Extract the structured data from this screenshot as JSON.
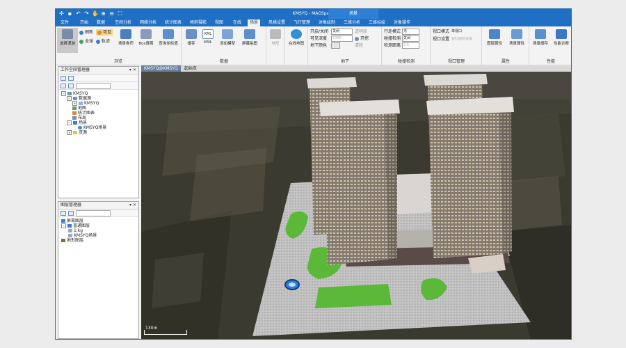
{
  "app": {
    "title": "KMSYQ - MAGSpace",
    "context_title": "场景",
    "quick_access_icons": [
      "app-logo-icon",
      "save-icon",
      "undo-icon",
      "redo-icon",
      "pan-icon",
      "zoom-in-icon",
      "zoom-out-icon",
      "full-extent-icon"
    ]
  },
  "tabs": [
    "文件",
    "开始",
    "数据",
    "空间分析",
    "网络分析",
    "统计图表",
    "倾斜摄影",
    "视图",
    "在线",
    "场景",
    "风格设置",
    "飞行管理",
    "对象绘制",
    "三维分析",
    "三维标绘",
    "对象操作"
  ],
  "active_tab": "场景",
  "ribbon": {
    "browse": {
      "label": "浏览",
      "select_mode": "选择漫游",
      "refresh": "刷新",
      "visible": "可见",
      "globe": "全球",
      "track": "轨迹",
      "scene_roll": "场景卷帘",
      "box_clip": "Box裁剪",
      "view_coord": "查询坐标值"
    },
    "data": {
      "label": "数据",
      "cache": "缓存",
      "kml": "KML",
      "add_model": "添加模型",
      "screen_image": "屏幕贴图",
      "terrain": "地形"
    },
    "online": {
      "online_map": "在线地图"
    },
    "underground": {
      "label": "地下",
      "open_close": "开启/关闭",
      "visible_depth": "可见深度",
      "underground_color": "地下颜色",
      "open_close_value": "关闭",
      "depth_value": "5000",
      "transparency": "透明度",
      "transparency_value": "50",
      "excavate": "开挖",
      "clear": "清除"
    },
    "collision": {
      "label": "碰撞检测",
      "walk_mode": "行走模式",
      "walk_mode_value": "无",
      "collision_check": "碰撞检测",
      "collision_check_value": "关闭",
      "check_distance": "检测距离",
      "check_distance_value": "0.5"
    },
    "viewport": {
      "label": "视口管理",
      "viewport_mode": "视口模式",
      "viewport_mode_value": "单视口",
      "viewport_settings": "视口设置",
      "viewport_settings_value": "视口图层设置"
    },
    "attributes": {
      "label": "属性",
      "layer_attr": "图层属性",
      "scene_attr": "场景属性"
    },
    "performance": {
      "label": "性能",
      "scene_cache": "场景缓存",
      "perf_diag": "性能诊断"
    }
  },
  "workspace_panel": {
    "title": "工作空间管理器",
    "tree": [
      {
        "label": "KMSYQ",
        "level": 0,
        "icon": "workspace"
      },
      {
        "label": "数据源",
        "level": 1,
        "icon": "datasource"
      },
      {
        "label": "KMSYQ",
        "level": 2,
        "icon": "db"
      },
      {
        "label": "地图",
        "level": 1,
        "icon": "map"
      },
      {
        "label": "统计图表",
        "level": 1,
        "icon": "chart"
      },
      {
        "label": "布局",
        "level": 1,
        "icon": "layout"
      },
      {
        "label": "场景",
        "level": 1,
        "icon": "scene"
      },
      {
        "label": "KMSYQ场景",
        "level": 2,
        "icon": "globe"
      },
      {
        "label": "资源",
        "level": 1,
        "icon": "folder"
      }
    ]
  },
  "layer_panel": {
    "title": "图层管理器",
    "tree": [
      {
        "label": "屏幕图层",
        "level": 0
      },
      {
        "label": "普通图层",
        "level": 0
      },
      {
        "label": "1.kg",
        "level": 1
      },
      {
        "label": "KMSYQ场景",
        "level": 1
      },
      {
        "label": "地形图层",
        "level": 0
      }
    ]
  },
  "document_tabs": [
    "KMSYQ@KMSYQ",
    "起始页"
  ],
  "scale_label": "130m",
  "colors": {
    "title_blue": "#1f6fc5",
    "building_wall": "#8a8078",
    "lawn": "#5cb838",
    "plaza": "#bdbdbd"
  }
}
